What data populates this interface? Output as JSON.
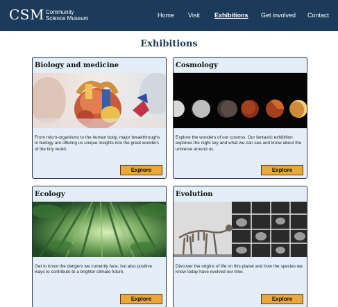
{
  "site": {
    "logo_mark": "CSM",
    "logo_line1": "Community",
    "logo_line2": "Science Museum"
  },
  "nav": {
    "items": [
      "Home",
      "Visit",
      "Exhibitions",
      "Get involved",
      "Contact"
    ],
    "active": "Exhibitions"
  },
  "page": {
    "title": "Exhibitions"
  },
  "cards": [
    {
      "title": "Biology and medicine",
      "image": "anatomical-heart-model-image",
      "description": "From micro-organisms to the human body, major breakthroughs in biology are offering us unique insights into the great wonders of the tiny world.",
      "button": "Explore"
    },
    {
      "title": "Cosmology",
      "image": "lunar-eclipse-phases-image",
      "description": "Explore the wonders of our cosmos. Our fantastic exhibition explores the night sky and what we can see and know about the universe around us.",
      "button": "Explore"
    },
    {
      "title": "Ecology",
      "image": "bamboo-forest-image",
      "description": "Get to know the dangers we currently face, but also positive ways to contribute to a brighter climate future.",
      "button": "Explore"
    },
    {
      "title": "Evolution",
      "image": "animal-skeletons-display-image",
      "description": "Discover the origins of life on this planet and how the species we know today have evolved our time.",
      "button": "Explore"
    }
  ],
  "colors": {
    "header_bg": "#1c3a5a",
    "card_bg": "#e3eef8",
    "button_bg": "#e9a83c"
  }
}
